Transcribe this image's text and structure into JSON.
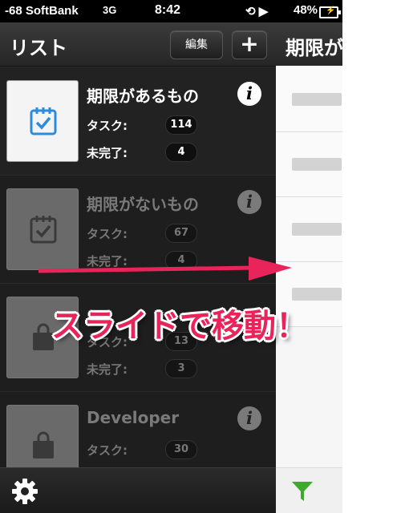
{
  "status_bar": {
    "carrier": "-68 SoftBank",
    "network": "3G",
    "time": "8:42",
    "battery": "48%"
  },
  "header": {
    "title": "リスト",
    "edit_label": "編集",
    "add_label": "+"
  },
  "lists": [
    {
      "title": "期限があるもの",
      "task_label": "タスク:",
      "task_count": "114",
      "incomplete_label": "未完了:",
      "incomplete_count": "4"
    },
    {
      "title": "期限がないもの",
      "task_label": "タスク:",
      "task_count": "67",
      "incomplete_label": "未完了:",
      "incomplete_count": "4"
    },
    {
      "title": "",
      "task_label": "タスク:",
      "task_count": "13",
      "incomplete_label": "未完了:",
      "incomplete_count": "3"
    },
    {
      "title": "Developer",
      "task_label": "タスク:",
      "task_count": "30",
      "incomplete_label": "",
      "incomplete_count": ""
    }
  ],
  "right_panel": {
    "title": "期限が"
  },
  "overlay": {
    "text": "スライドで移動！"
  },
  "colors": {
    "accent_pink": "#e8245a",
    "filter_green": "#3cab2b",
    "calendar_blue": "#2a8be0"
  },
  "icons": {
    "info": "i",
    "settings": "gear-icon",
    "filter": "funnel-icon"
  }
}
